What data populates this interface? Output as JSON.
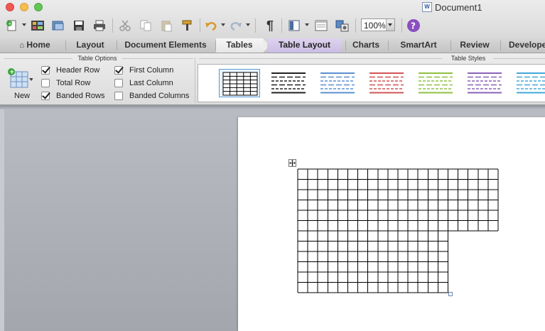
{
  "window": {
    "title": "Document1",
    "app_icon": "word-doc-icon"
  },
  "toolbar": {
    "zoom_value": "100%",
    "icons": [
      "new-document-icon",
      "templates-icon",
      "open-icon",
      "save-icon",
      "print-icon",
      "cut-icon",
      "copy-icon",
      "paste-icon",
      "format-painter-icon",
      "undo-icon",
      "redo-icon",
      "show-paragraph-icon",
      "sidebar-icon",
      "gallery-icon",
      "media-browser-icon",
      "help-icon"
    ]
  },
  "tabs": [
    "Home",
    "Layout",
    "Document Elements",
    "Tables",
    "Table Layout",
    "Charts",
    "SmartArt",
    "Review",
    "Develope"
  ],
  "ribbon": {
    "table_options": {
      "title": "Table Options",
      "new_label": "New",
      "options": [
        {
          "label": "Header Row",
          "checked": true
        },
        {
          "label": "Total Row",
          "checked": false
        },
        {
          "label": "Banded Rows",
          "checked": true
        },
        {
          "label": "First Column",
          "checked": true
        },
        {
          "label": "Last Column",
          "checked": false
        },
        {
          "label": "Banded Columns",
          "checked": false
        }
      ]
    },
    "table_styles": {
      "title": "Table Styles",
      "styles": [
        {
          "name": "grid-black",
          "color": "#000000"
        },
        {
          "name": "banded-black",
          "color": "#222222"
        },
        {
          "name": "banded-blue",
          "color": "#5b8fd0"
        },
        {
          "name": "banded-red",
          "color": "#d05454"
        },
        {
          "name": "banded-green",
          "color": "#8fc043"
        },
        {
          "name": "banded-purple",
          "color": "#8a62b8"
        },
        {
          "name": "banded-cyan",
          "color": "#42a8d8"
        }
      ]
    }
  },
  "document": {
    "table": {
      "columns": 20,
      "rows_full_width": 6,
      "rows_narrow": 6,
      "narrow_columns": 15
    }
  },
  "colors": {
    "close": "#ee5a52",
    "minimize": "#f5be4f",
    "zoom": "#62c655",
    "selected_tab": "#cbbde4"
  }
}
